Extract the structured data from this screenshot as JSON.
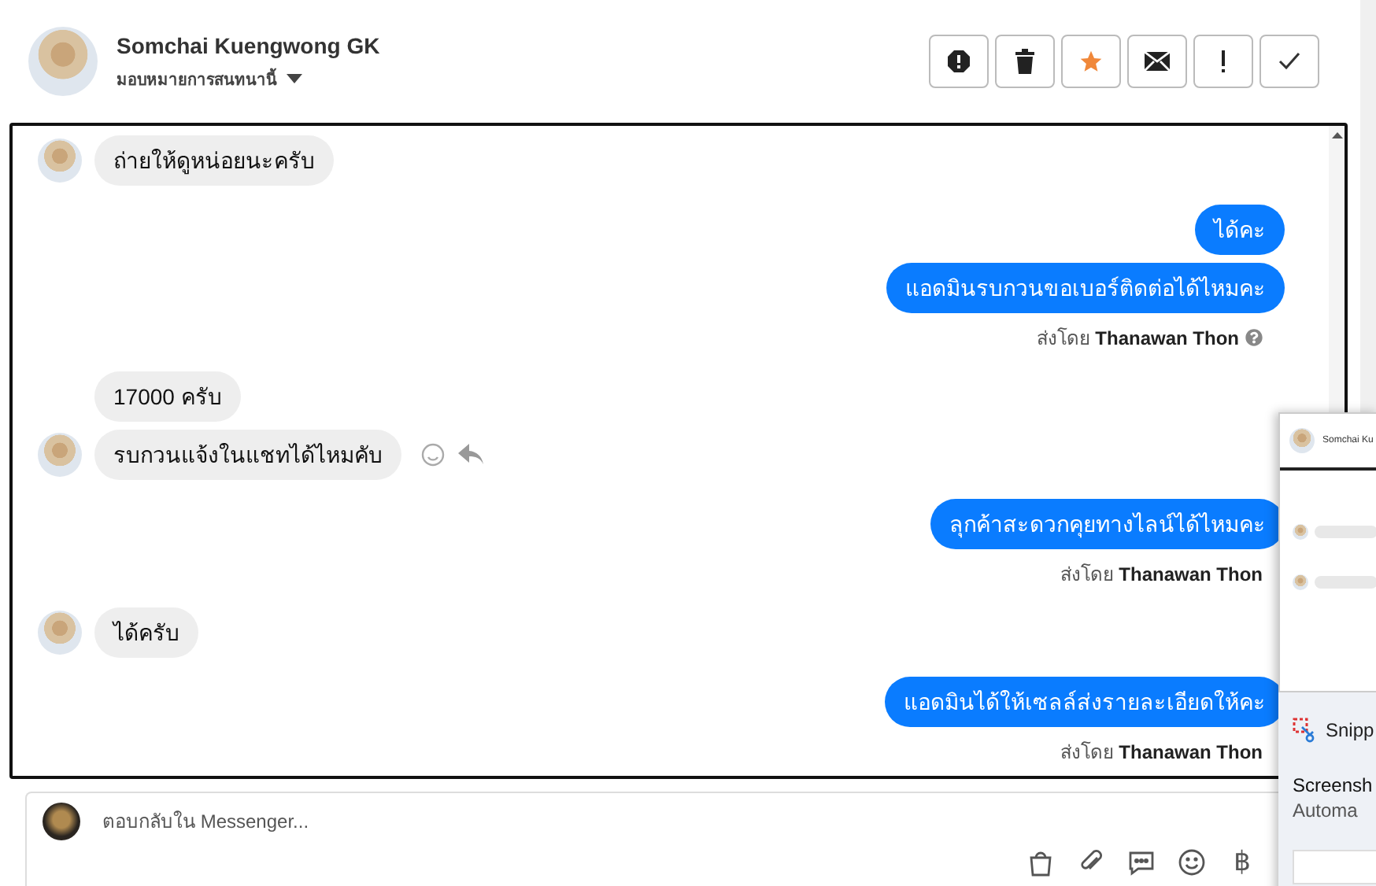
{
  "header": {
    "name": "Somchai Kuengwong GK",
    "assign_label": "มอบหมายการสนทนานี้",
    "actions": [
      {
        "kind": "spam"
      },
      {
        "kind": "delete"
      },
      {
        "kind": "star",
        "on": true
      },
      {
        "kind": "unread"
      },
      {
        "kind": "important"
      },
      {
        "kind": "done"
      }
    ]
  },
  "messages": [
    {
      "kind": "incoming",
      "avatar": true,
      "text": "ถ่ายให้ดูหน่อยนะครับ",
      "actions_visible": false
    },
    {
      "kind": "outgoing",
      "text": "ได้คะ"
    },
    {
      "kind": "outgoing",
      "text": "แอดมินรบกวนขอเบอร์ติดต่อได้ไหมคะ"
    },
    {
      "kind": "sent_by",
      "prefix": "ส่งโดย",
      "name": "Thanawan Thon",
      "help": true
    },
    {
      "kind": "incoming",
      "avatar": false,
      "text": "17000 ครับ",
      "actions_visible": false
    },
    {
      "kind": "incoming",
      "avatar": true,
      "text": "รบกวนแจ้งในแชทได้ไหมคับ",
      "actions_visible": true
    },
    {
      "kind": "outgoing",
      "text": "ลุกค้าสะดวกคุยทางไลน์ได้ไหมคะ"
    },
    {
      "kind": "sent_by",
      "prefix": "ส่งโดย",
      "name": "Thanawan Thon",
      "help": false
    },
    {
      "kind": "incoming",
      "avatar": true,
      "text": "ได้ครับ",
      "actions_visible": false
    },
    {
      "kind": "outgoing",
      "text": "แอดมินได้ให้เซลล์ส่งรายละเอียดให้คะ"
    },
    {
      "kind": "sent_by",
      "prefix": "ส่งโดย",
      "name": "Thanawan Thon",
      "help": false
    }
  ],
  "composer": {
    "placeholder": "ตอบกลับใน Messenger...",
    "tools": [
      {
        "kind": "bag"
      },
      {
        "kind": "attach"
      },
      {
        "kind": "chat"
      },
      {
        "kind": "emoji"
      },
      {
        "kind": "currency",
        "symbol": "฿"
      }
    ]
  },
  "notification": {
    "preview_title": "Somchai Ku",
    "app": "Snipp",
    "title": "Screensh",
    "body": "Automa"
  }
}
